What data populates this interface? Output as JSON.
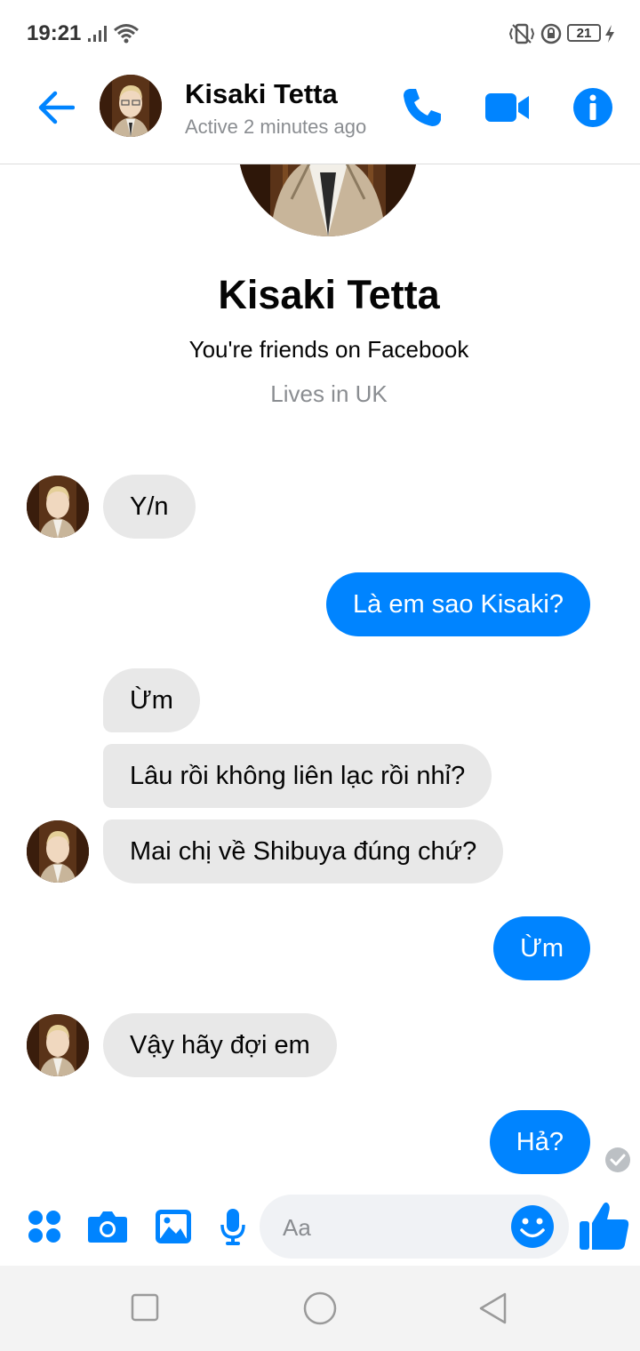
{
  "status_bar": {
    "time": "19:21",
    "battery": "21"
  },
  "header": {
    "name": "Kisaki Tetta",
    "status": "Active 2 minutes ago"
  },
  "profile": {
    "name": "Kisaki Tetta",
    "friends_text": "You're friends on Facebook",
    "location": "Lives in UK"
  },
  "messages": [
    {
      "from": "them",
      "text": "Y/n"
    },
    {
      "from": "me",
      "text": "Là em sao Kisaki?"
    },
    {
      "from": "them",
      "text": "Ừm"
    },
    {
      "from": "them",
      "text": "Lâu rồi không liên lạc rồi nhỉ?"
    },
    {
      "from": "them",
      "text": "Mai chị về Shibuya đúng chứ?"
    },
    {
      "from": "me",
      "text": "Ừm"
    },
    {
      "from": "them",
      "text": "Vậy hãy đợi em"
    },
    {
      "from": "me",
      "text": "Hả?"
    }
  ],
  "composer": {
    "placeholder": "Aa"
  },
  "colors": {
    "accent": "#0084ff",
    "incoming_bubble": "#e8e8e8",
    "outgoing_text": "#ffffff"
  },
  "icons": [
    "back-arrow-icon",
    "phone-icon",
    "video-camera-icon",
    "info-icon",
    "apps-icon",
    "camera-icon",
    "gallery-icon",
    "microphone-icon",
    "emoji-icon",
    "thumbs-up-icon",
    "seen-check-icon"
  ]
}
